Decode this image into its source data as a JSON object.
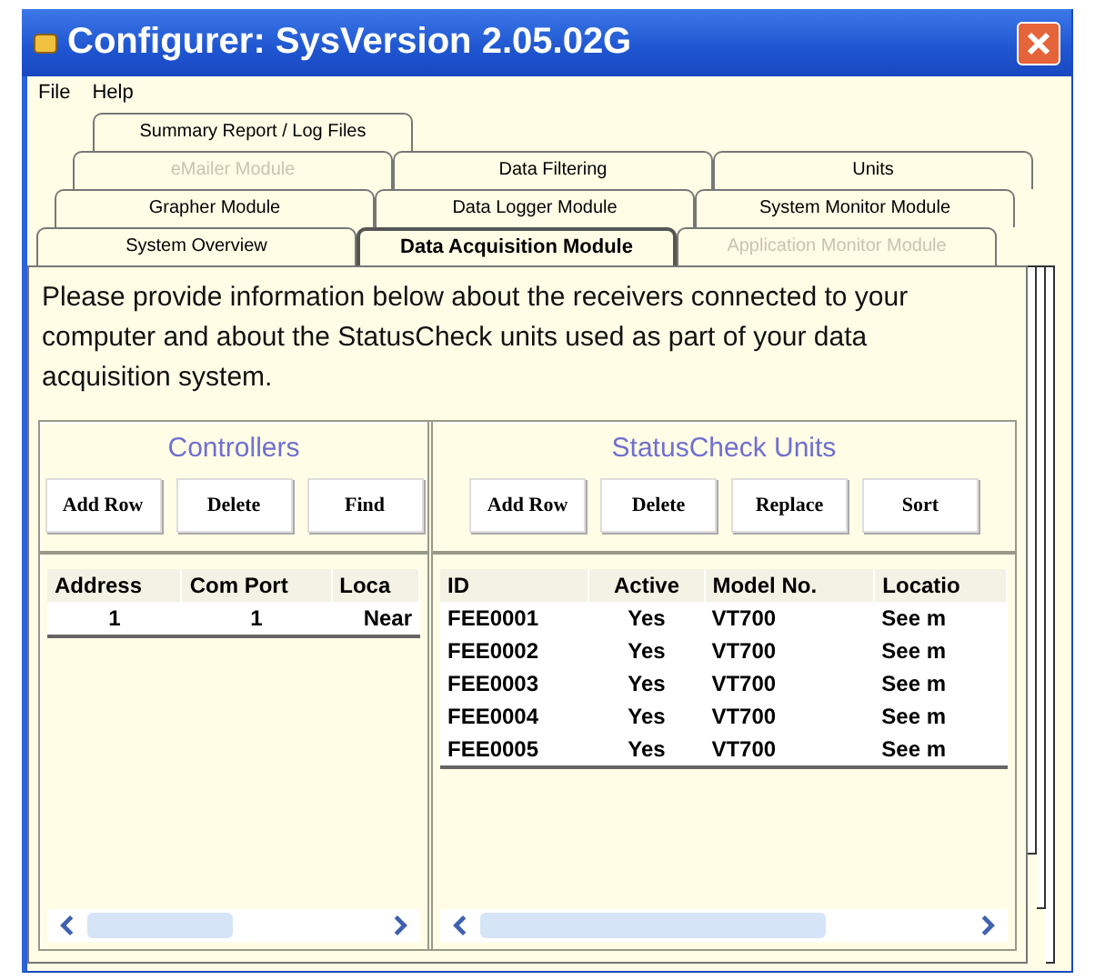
{
  "window": {
    "title": "Configurer:  SysVersion 2.05.02G"
  },
  "menu": [
    "File",
    "Help"
  ],
  "tab_rows": [
    [
      {
        "label": "Summary Report / Log Files",
        "selected": false,
        "disabled": false
      }
    ],
    [
      {
        "label": "eMailer Module",
        "selected": false,
        "disabled": true
      },
      {
        "label": "Data Filtering",
        "selected": false,
        "disabled": false
      },
      {
        "label": "Units",
        "selected": false,
        "disabled": false
      }
    ],
    [
      {
        "label": "Grapher Module",
        "selected": false,
        "disabled": false
      },
      {
        "label": "Data Logger Module",
        "selected": false,
        "disabled": false
      },
      {
        "label": "System Monitor Module",
        "selected": false,
        "disabled": false
      }
    ],
    [
      {
        "label": "System Overview",
        "selected": false,
        "disabled": false
      },
      {
        "label": "Data Acquisition Module",
        "selected": true,
        "disabled": false
      },
      {
        "label": "Application Monitor Module",
        "selected": false,
        "disabled": true
      }
    ]
  ],
  "intro": "Please provide information below about the receivers connected to your computer and about the StatusCheck units used as part of your data acquisition system.",
  "panes": [
    {
      "title": "Controllers",
      "buttons": [
        "Add Row",
        "Delete",
        "Find"
      ],
      "columns": [
        "Address",
        "Com Port",
        "Loca"
      ],
      "rows": [
        [
          "1",
          "1",
          "Near"
        ]
      ]
    },
    {
      "title": "StatusCheck Units",
      "buttons": [
        "Add Row",
        "Delete",
        "Replace",
        "Sort"
      ],
      "columns": [
        "ID",
        "Active",
        "Model No.",
        "Locatio"
      ],
      "rows": [
        [
          "FEE0001",
          "Yes",
          "VT700",
          "See m"
        ],
        [
          "FEE0002",
          "Yes",
          "VT700",
          "See m"
        ],
        [
          "FEE0003",
          "Yes",
          "VT700",
          "See m"
        ],
        [
          "FEE0004",
          "Yes",
          "VT700",
          "See m"
        ],
        [
          "FEE0005",
          "Yes",
          "VT700",
          "See m"
        ]
      ]
    }
  ]
}
